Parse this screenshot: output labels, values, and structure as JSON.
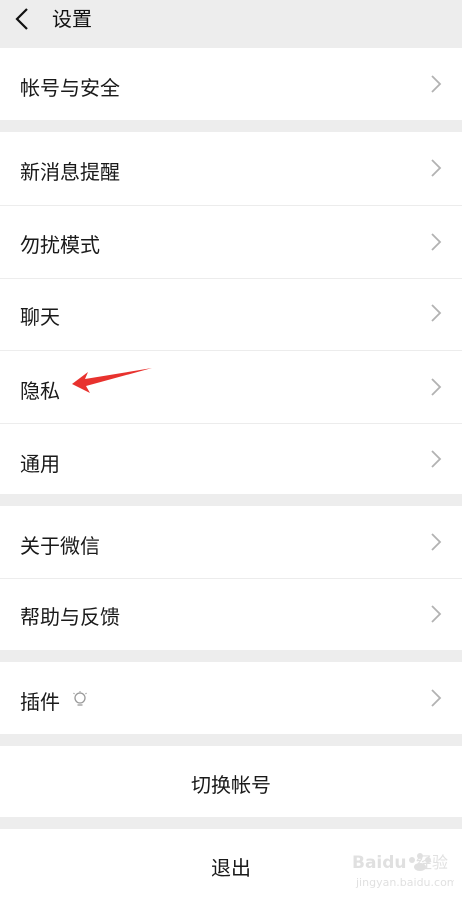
{
  "header": {
    "title": "设置"
  },
  "groups": [
    {
      "items": [
        {
          "label": "帐号与安全"
        }
      ]
    },
    {
      "items": [
        {
          "label": "新消息提醒"
        },
        {
          "label": "勿扰模式"
        },
        {
          "label": "聊天"
        },
        {
          "label": "隐私"
        },
        {
          "label": "通用"
        }
      ]
    },
    {
      "items": [
        {
          "label": "关于微信"
        },
        {
          "label": "帮助与反馈"
        }
      ]
    },
    {
      "items": [
        {
          "label": "插件",
          "icon": "bulb-icon"
        }
      ]
    }
  ],
  "actions": {
    "switch_account": "切换帐号",
    "logout": "退出"
  },
  "annotation": {
    "arrow_color": "#e8322e"
  },
  "watermark": {
    "brand": "Baidu",
    "brand_cn": "经验",
    "url": "jingyan.baidu.com"
  },
  "colors": {
    "background": "#ededed",
    "row": "#ffffff",
    "chevron": "#b2b2b2",
    "text": "#1a1a1a"
  }
}
